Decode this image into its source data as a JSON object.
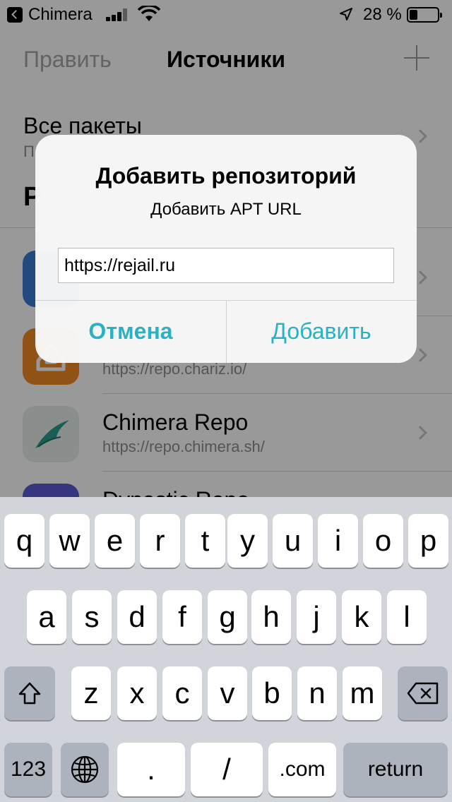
{
  "status_bar": {
    "back_app": "Chimera",
    "battery_percent": "28 %",
    "battery_level": 0.28
  },
  "nav": {
    "edit": "Править",
    "title": "Источники"
  },
  "all_packages": {
    "title": "Все пакеты",
    "subtitle_visible": "П"
  },
  "section": {
    "header_visible": "Р"
  },
  "repos": [
    {
      "name": "",
      "url": "",
      "icon": "blue-repo-icon",
      "color": "#3a7bd5"
    },
    {
      "name": "",
      "url": "https://repo.chariz.io/",
      "icon": "chariz-icon",
      "color": "#f08a24"
    },
    {
      "name": "Chimera Repo",
      "url": "https://repo.chimera.sh/",
      "icon": "chimera-icon",
      "color": "#e6edec"
    },
    {
      "name": "Dynastic Repo",
      "url": "",
      "icon": "dynastic-icon",
      "color": "#5b5bd6"
    }
  ],
  "alert": {
    "title": "Добавить репозиторий",
    "message": "Добавить APT URL",
    "input_value": "https://rejail.ru",
    "cancel": "Отмена",
    "confirm": "Добавить",
    "accent_color": "#2bb1c4"
  },
  "keyboard": {
    "row1": [
      "q",
      "w",
      "e",
      "r",
      "t",
      "y",
      "u",
      "i",
      "o",
      "p"
    ],
    "row2": [
      "a",
      "s",
      "d",
      "f",
      "g",
      "h",
      "j",
      "k",
      "l"
    ],
    "row3": [
      "z",
      "x",
      "c",
      "v",
      "b",
      "n",
      "m"
    ],
    "numbers": "123",
    "dot": ".",
    "slash": "/",
    "dotcom": ".com",
    "return": "return"
  }
}
